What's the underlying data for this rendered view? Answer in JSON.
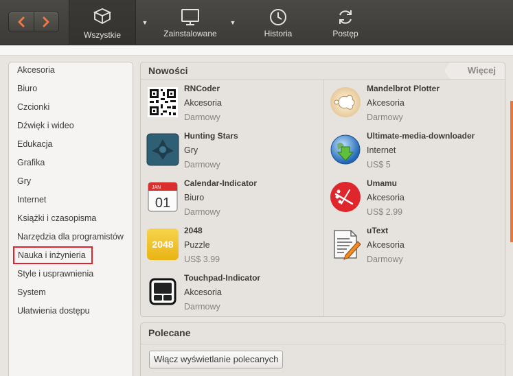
{
  "toolbar": {
    "back_icon": "chevron-left-icon",
    "forward_icon": "chevron-right-icon",
    "tabs": [
      {
        "label": "Wszystkie",
        "icon": "box-icon",
        "active": true
      },
      {
        "label": "Zainstalowane",
        "icon": "monitor-icon"
      },
      {
        "label": "Historia",
        "icon": "clock-icon"
      },
      {
        "label": "Postęp",
        "icon": "refresh-icon"
      }
    ],
    "accent": "#f07746"
  },
  "sidebar": {
    "items": [
      {
        "label": "Akcesoria"
      },
      {
        "label": "Biuro"
      },
      {
        "label": "Czcionki"
      },
      {
        "label": "Dźwięk i wideo"
      },
      {
        "label": "Edukacja"
      },
      {
        "label": "Grafika"
      },
      {
        "label": "Gry"
      },
      {
        "label": "Internet"
      },
      {
        "label": "Książki i czasopisma"
      },
      {
        "label": "Narzędzia dla programistów"
      },
      {
        "label": "Nauka i inżynieria",
        "selected": true
      },
      {
        "label": "Style i usprawnienia"
      },
      {
        "label": "System"
      },
      {
        "label": "Ułatwienia dostępu"
      }
    ],
    "highlight_color": "#e3202c"
  },
  "new_apps": {
    "title": "Nowości",
    "more_label": "Więcej",
    "apps": [
      {
        "name": "RNCoder",
        "category": "Akcesoria",
        "price": "Darmowy",
        "icon": "qr-code-icon"
      },
      {
        "name": "Mandelbrot Plotter",
        "category": "Akcesoria",
        "price": "Darmowy",
        "icon": "mandelbrot-icon"
      },
      {
        "name": "Hunting Stars",
        "category": "Gry",
        "price": "Darmowy",
        "icon": "spaceship-icon"
      },
      {
        "name": "Ultimate-media-downloader",
        "category": "Internet",
        "price": "US$ 5",
        "icon": "globe-download-icon"
      },
      {
        "name": "Calendar-Indicator",
        "category": "Biuro",
        "price": "Darmowy",
        "icon": "calendar-icon"
      },
      {
        "name": "Umamu",
        "category": "Akcesoria",
        "price": "US$ 2.99",
        "icon": "umamu-icon"
      },
      {
        "name": "2048",
        "category": "Puzzle",
        "price": "US$ 3.99",
        "icon": "game-2048-icon"
      },
      {
        "name": "uText",
        "category": "Akcesoria",
        "price": "Darmowy",
        "icon": "text-editor-icon"
      },
      {
        "name": "Touchpad-Indicator",
        "category": "Akcesoria",
        "price": "Darmowy",
        "icon": "touchpad-icon"
      }
    ],
    "calendar": {
      "month": "JAN",
      "day": "01"
    },
    "game_2048_label": "2048"
  },
  "recommended": {
    "title": "Polecane",
    "button_label": "Włącz wyświetlanie polecanych"
  }
}
